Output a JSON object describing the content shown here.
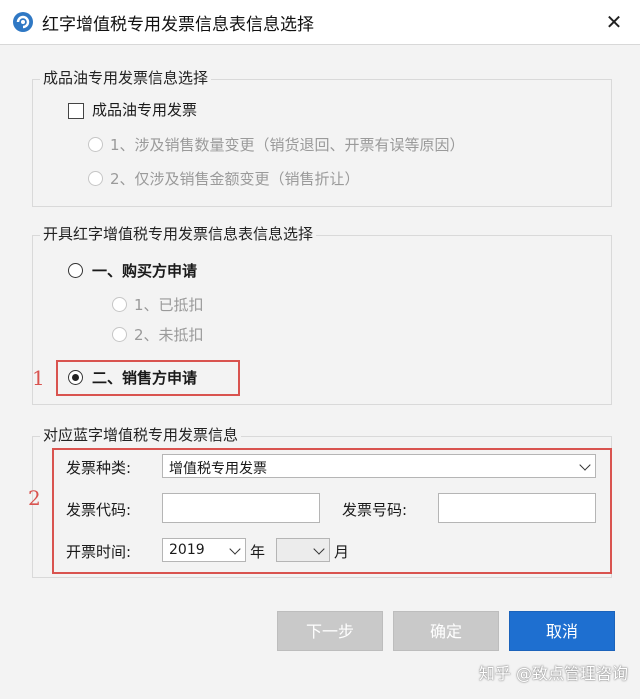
{
  "window": {
    "title": "红字增值税专用发票信息表信息选择",
    "close_glyph": "✕"
  },
  "oil_group": {
    "legend": "成品油专用发票信息选择",
    "checkbox_label": "成品油专用发票",
    "option1": "1、涉及销售数量变更（销货退回、开票有误等原因）",
    "option2": "2、仅涉及销售金额变更（销售折让）"
  },
  "apply_group": {
    "legend": "开具红字增值税专用发票信息表信息选择",
    "buyer_label": "一、购买方申请",
    "buyer_sub1": "1、已抵扣",
    "buyer_sub2": "2、未抵扣",
    "seller_label": "二、销售方申请"
  },
  "annotations": {
    "mark1": "1",
    "mark2": "2",
    "color": "#d9534f"
  },
  "blue_group": {
    "legend": "对应蓝字增值税专用发票信息",
    "invoice_type_label": "发票种类:",
    "invoice_type_value": "增值税专用发票",
    "invoice_code_label": "发票代码:",
    "invoice_code_value": "",
    "invoice_number_label": "发票号码:",
    "invoice_number_value": "",
    "date_label": "开票时间:",
    "year_value": "2019",
    "year_suffix": "年",
    "month_value": "",
    "month_suffix": "月"
  },
  "buttons": {
    "next": "下一步",
    "confirm": "确定",
    "cancel": "取消"
  },
  "watermark": "知乎 @致点管理咨询",
  "colors": {
    "primary_button": "#1e6fd0",
    "disabled_button": "#c9c9c9",
    "highlight_red": "#d9534f"
  }
}
